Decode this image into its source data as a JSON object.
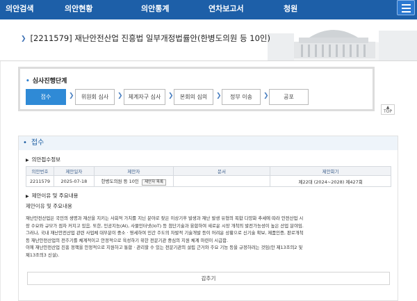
{
  "nav": {
    "items": [
      "의안검색",
      "의안현황",
      "의안통계",
      "연차보고서",
      "청원"
    ],
    "menu_icon": "hamburger-icon"
  },
  "bill": {
    "title": "[2211579] 재난안전산업 진흥법 일부개정법률안(한병도의원 등 10인)"
  },
  "steps": {
    "heading": "심사진행단계",
    "items": [
      "접수",
      "위원회 심사",
      "체계자구 심사",
      "본회의 심의",
      "정부 이송",
      "공포"
    ],
    "active_index": 0
  },
  "top_button": "TOP",
  "received": {
    "heading": "접수",
    "info_title": "의안접수정보",
    "table": {
      "headers": [
        "의안번호",
        "제안일자",
        "제안자",
        "문서",
        "제안회기"
      ],
      "row": {
        "bill_no": "2211579",
        "date": "2025-07-18",
        "proposer": "한병도의원 등 10인",
        "proposer_button": "제안자 목록",
        "document": "",
        "session": "제22대 (2024~2028) 제427회"
      }
    },
    "reason_title": "제안이유 및 주요내용",
    "reason_label": "제안이유 및 주요내용",
    "reason_lines": [
      "재난안전산업은 국민의 생명과 재산을 지키는 사회적 가치를 지닌 분야로 잦은 이상기후 발생과 재난 발생 유형의 복합 다양화 추세에 따라 안전산업 시",
      "장 수요와 규모가 점차 커지고 있음. 또한, 인공지능(AI), 사물인터넷(IoT) 등 첨단기술과 융합하여 새로운 시장 개척의 발전가능성이 높은 산업 분야임.",
      "그러나, 국내 재난안전산업 관련 사업체 대부분이 중소 · 영세하여 민간 주도의 자발적 기술개발 등이 어려운 상황으로 신기술 확보, 제품인증, 판로개척",
      "등 재난안전산업의 전주기를 체계적이고 안정적으로 육성하기 위한 전문기관 중심의 지원 체계 마련이 시급함.",
      "이에 재난안전산업 진흥 정책을 안정적으로 지원하고 통합 · 관리할 수 있는 전문기관의 설립 근거와 주요 기능 등을 규정하려는 것임(안 제13조의2 및",
      "제13조의3 신설)."
    ],
    "collapse_label": "감추기"
  },
  "colors": {
    "nav_bg": "#1d5fa8",
    "accent": "#2f8ad6",
    "section_bg": "#eef4fa"
  }
}
